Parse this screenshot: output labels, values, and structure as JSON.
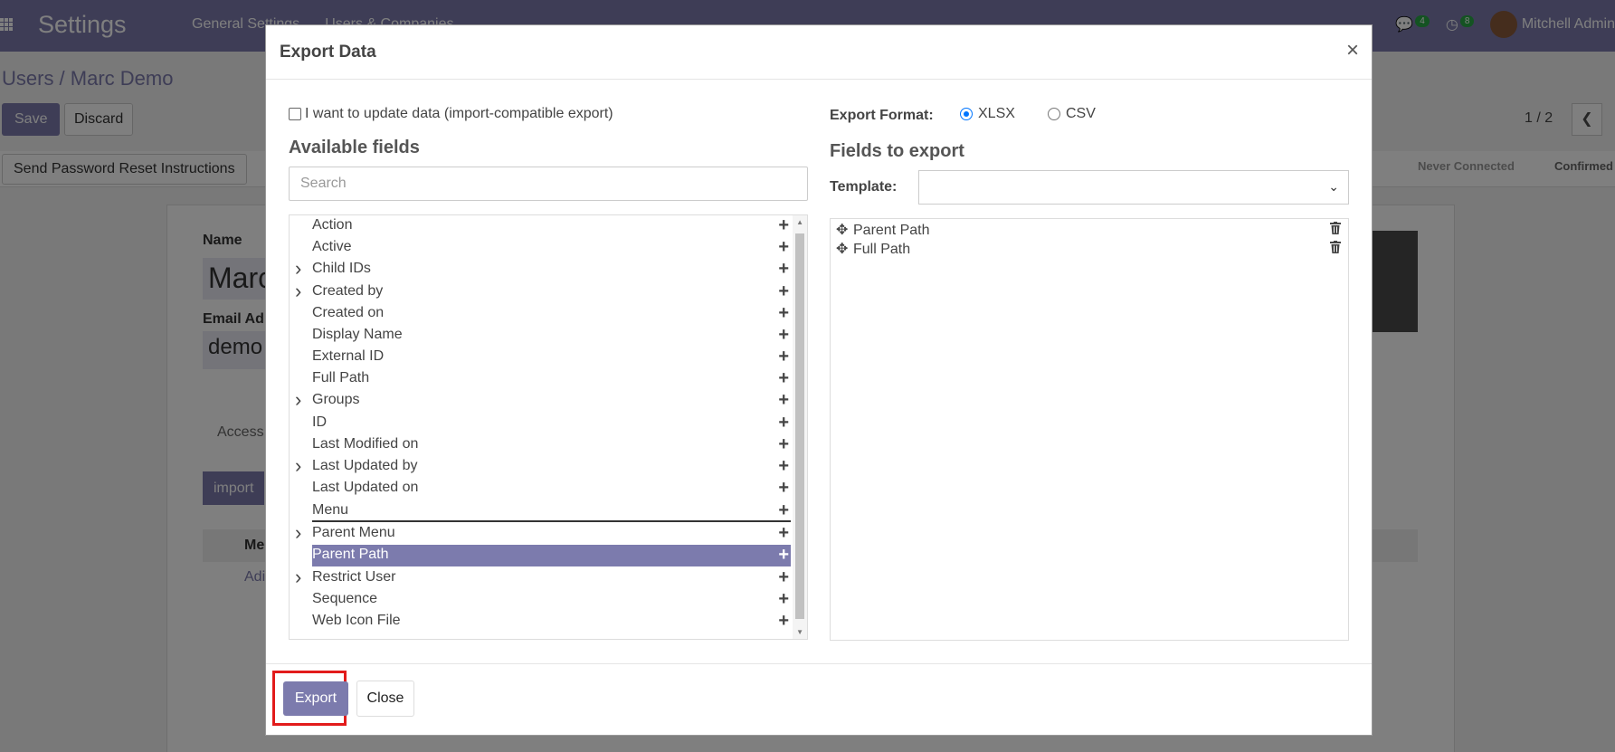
{
  "app": {
    "brand": "Settings",
    "menu": [
      "General Settings",
      "Users & Companies"
    ],
    "systray": {
      "messages_count": "4",
      "activities_count": "8",
      "user_name": "Mitchell Admin"
    }
  },
  "form": {
    "breadcrumb": "Users / Marc Demo",
    "save_label": "Save",
    "discard_label": "Discard",
    "pager": "1 / 2",
    "reset_button": "Send Password Reset Instructions",
    "stages": [
      "Never Connected",
      "Confirmed"
    ],
    "name_label": "Name",
    "name_value": "Marc",
    "email_label": "Email Ad",
    "email_value": "demo",
    "tab": "Access",
    "import_label": "import",
    "col_header": "Me",
    "row_value": "Adi"
  },
  "dialog": {
    "title": "Export Data",
    "close_icon": "×",
    "import_compat_label": "I want to update data (import-compatible export)",
    "available_title": "Available fields",
    "search_placeholder": "Search",
    "export_format_label": "Export Format:",
    "formats": [
      {
        "label": "XLSX",
        "selected": true
      },
      {
        "label": "CSV",
        "selected": false
      }
    ],
    "fields_to_export_title": "Fields to export",
    "template_label": "Template:",
    "template_value": "",
    "available_fields": [
      {
        "label": "Action",
        "expandable": false
      },
      {
        "label": "Active",
        "expandable": false
      },
      {
        "label": "Child IDs",
        "expandable": true
      },
      {
        "label": "Created by",
        "expandable": true
      },
      {
        "label": "Created on",
        "expandable": false
      },
      {
        "label": "Display Name",
        "expandable": false
      },
      {
        "label": "External ID",
        "expandable": false
      },
      {
        "label": "Full Path",
        "expandable": false
      },
      {
        "label": "Groups",
        "expandable": true
      },
      {
        "label": "ID",
        "expandable": false
      },
      {
        "label": "Last Modified on",
        "expandable": false
      },
      {
        "label": "Last Updated by",
        "expandable": true
      },
      {
        "label": "Last Updated on",
        "expandable": false
      },
      {
        "label": "Menu",
        "expandable": false
      },
      {
        "label": "Parent Menu",
        "expandable": true
      },
      {
        "label": "Parent Path",
        "expandable": false,
        "selected": true
      },
      {
        "label": "Restrict User",
        "expandable": true
      },
      {
        "label": "Sequence",
        "expandable": false
      },
      {
        "label": "Web Icon File",
        "expandable": false
      }
    ],
    "fields_to_export": [
      "Parent Path",
      "Full Path"
    ],
    "export_button": "Export",
    "close_button": "Close"
  }
}
